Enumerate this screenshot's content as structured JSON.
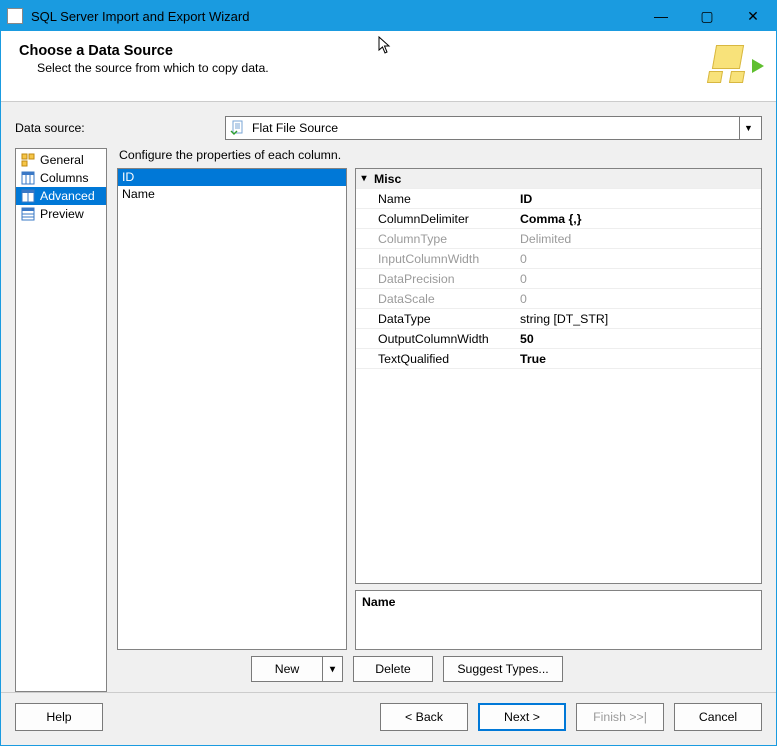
{
  "window": {
    "title": "SQL Server Import and Export Wizard"
  },
  "header": {
    "title": "Choose a Data Source",
    "subtitle": "Select the source from which to copy data."
  },
  "datasource": {
    "label": "Data source:",
    "selected": "Flat File Source"
  },
  "nav": {
    "items": [
      {
        "label": "General",
        "selected": false,
        "icon": "general-icon"
      },
      {
        "label": "Columns",
        "selected": false,
        "icon": "columns-icon"
      },
      {
        "label": "Advanced",
        "selected": true,
        "icon": "advanced-icon"
      },
      {
        "label": "Preview",
        "selected": false,
        "icon": "preview-icon"
      }
    ]
  },
  "main": {
    "instruction": "Configure the properties of each column.",
    "columns": [
      {
        "label": "ID",
        "selected": true
      },
      {
        "label": "Name",
        "selected": false
      }
    ],
    "propcategory": "Misc",
    "properties": [
      {
        "name": "Name",
        "value": "ID",
        "bold": true,
        "disabled": false
      },
      {
        "name": "ColumnDelimiter",
        "value": "Comma {,}",
        "bold": true,
        "disabled": false
      },
      {
        "name": "ColumnType",
        "value": "Delimited",
        "bold": false,
        "disabled": true
      },
      {
        "name": "InputColumnWidth",
        "value": "0",
        "bold": false,
        "disabled": true
      },
      {
        "name": "DataPrecision",
        "value": "0",
        "bold": false,
        "disabled": true
      },
      {
        "name": "DataScale",
        "value": "0",
        "bold": false,
        "disabled": true
      },
      {
        "name": "DataType",
        "value": "string [DT_STR]",
        "bold": false,
        "disabled": false
      },
      {
        "name": "OutputColumnWidth",
        "value": "50",
        "bold": true,
        "disabled": false
      },
      {
        "name": "TextQualified",
        "value": "True",
        "bold": true,
        "disabled": false
      }
    ],
    "desc_title": "Name"
  },
  "actions": {
    "new": "New",
    "delete": "Delete",
    "suggest": "Suggest Types..."
  },
  "footer": {
    "help": "Help",
    "back": "< Back",
    "next": "Next >",
    "finish": "Finish >>|",
    "cancel": "Cancel"
  }
}
